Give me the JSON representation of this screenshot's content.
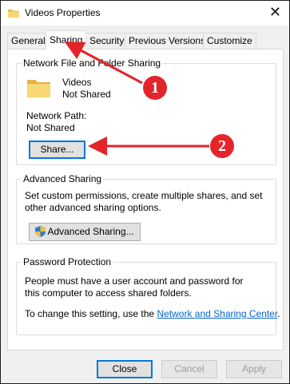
{
  "window": {
    "title": "Videos Properties",
    "close_symbol": "✕"
  },
  "tabs": [
    {
      "label": "General"
    },
    {
      "label": "Sharing",
      "active": true
    },
    {
      "label": "Security"
    },
    {
      "label": "Previous Versions"
    },
    {
      "label": "Customize"
    }
  ],
  "network_sharing": {
    "title": "Network File and Folder Sharing",
    "folder_name": "Videos",
    "folder_status": "Not Shared",
    "path_label": "Network Path:",
    "path_value": "Not Shared",
    "share_button": "Share..."
  },
  "advanced_sharing": {
    "title": "Advanced Sharing",
    "description": "Set custom permissions, create multiple shares, and set other advanced sharing options.",
    "button": "Advanced Sharing..."
  },
  "password_protection": {
    "title": "Password Protection",
    "description": "People must have a user account and password for this computer to access shared folders.",
    "change_prefix": "To change this setting, use the ",
    "link": "Network and Sharing Center",
    "change_suffix": "."
  },
  "footer": {
    "close": "Close",
    "cancel": "Cancel",
    "apply": "Apply"
  },
  "annotations": [
    {
      "number": "1"
    },
    {
      "number": "2"
    }
  ],
  "colors": {
    "annotation": "#e3242b",
    "link": "#0066cc",
    "focus": "#0078d7",
    "folder": "#f8d775"
  }
}
